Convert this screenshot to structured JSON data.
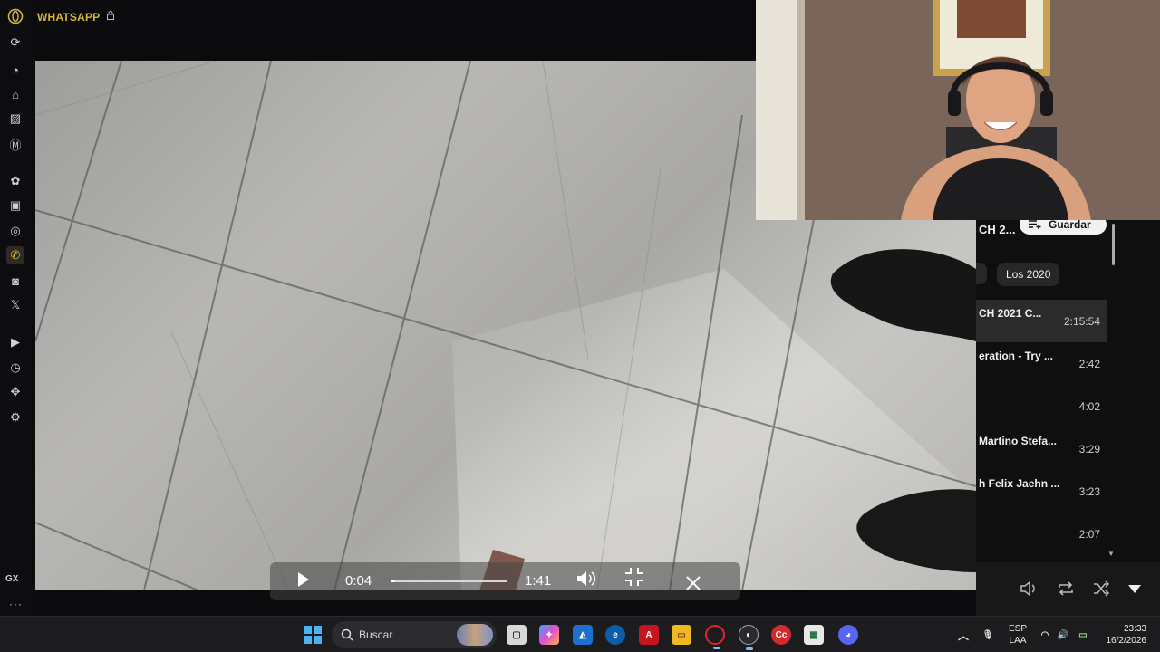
{
  "browser": {
    "panel_title": "WHATSAPP",
    "sidebar_items": [
      "reload-icon",
      "speed-dial-icon",
      "gx-store-icon",
      "wallet-icon",
      "mailbox-icon",
      "chatgpt-icon",
      "twitch-icon",
      "messenger-icon",
      "whatsapp-icon",
      "instagram-icon",
      "x-icon",
      "player-icon",
      "history-icon",
      "extensions-icon",
      "settings-icon"
    ],
    "gx_label": "GX",
    "more_label": "···",
    "accent": "#d8b640"
  },
  "video_player": {
    "current_time": "0:04",
    "duration": "1:41",
    "progress": 0.04
  },
  "playlist": {
    "title": "CH 2...",
    "save_label": "Guardar",
    "chip": "Los 2020",
    "items": [
      {
        "title": "CH 2021 C...",
        "time": "2:15:54",
        "active": true
      },
      {
        "title": "eration - Try ...",
        "time": "2:42",
        "active": false
      },
      {
        "title": "",
        "time": "4:02",
        "active": false
      },
      {
        "title": "Martino Stefa...",
        "time": "3:29",
        "active": false
      },
      {
        "title": "h Felix Jaehn ...",
        "time": "3:23",
        "active": false
      },
      {
        "title": "",
        "time": "2:07",
        "active": false
      }
    ]
  },
  "taskbar": {
    "search_placeholder": "Buscar",
    "language_top": "ESP",
    "language_bottom": "LAA",
    "time": "23:33",
    "date": "16/2/2026"
  }
}
